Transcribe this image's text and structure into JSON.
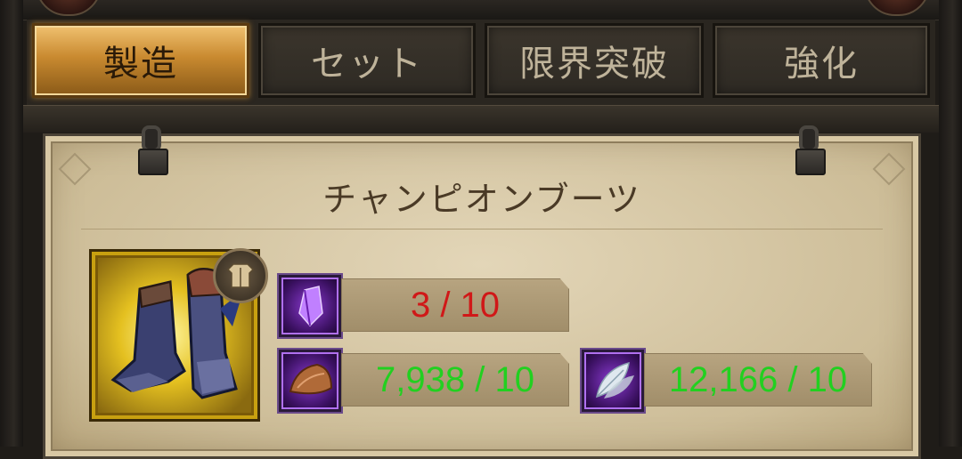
{
  "tabs": [
    {
      "label": "製造",
      "active": true
    },
    {
      "label": "セット",
      "active": false
    },
    {
      "label": "限界突破",
      "active": false
    },
    {
      "label": "強化",
      "active": false
    }
  ],
  "item": {
    "name": "チャンピオンブーツ",
    "icon": "champion-boots-icon",
    "type_badge_icon": "armor-badge-icon"
  },
  "materials": [
    {
      "icon": "purple-crystal-icon",
      "owned": "3",
      "required": "10",
      "text": "3 / 10",
      "color": "#d01818"
    },
    {
      "icon": "leather-icon",
      "owned": "7,938",
      "required": "10",
      "text": "7,938 / 10",
      "color": "#22d020"
    },
    {
      "icon": "feather-icon",
      "owned": "12,166",
      "required": "10",
      "text": "12,166 / 10",
      "color": "#22d020"
    }
  ],
  "colors": {
    "insufficient": "#d01818",
    "sufficient": "#22d020",
    "active_tab": "#d9a14a",
    "parchment": "#d8cbab"
  }
}
